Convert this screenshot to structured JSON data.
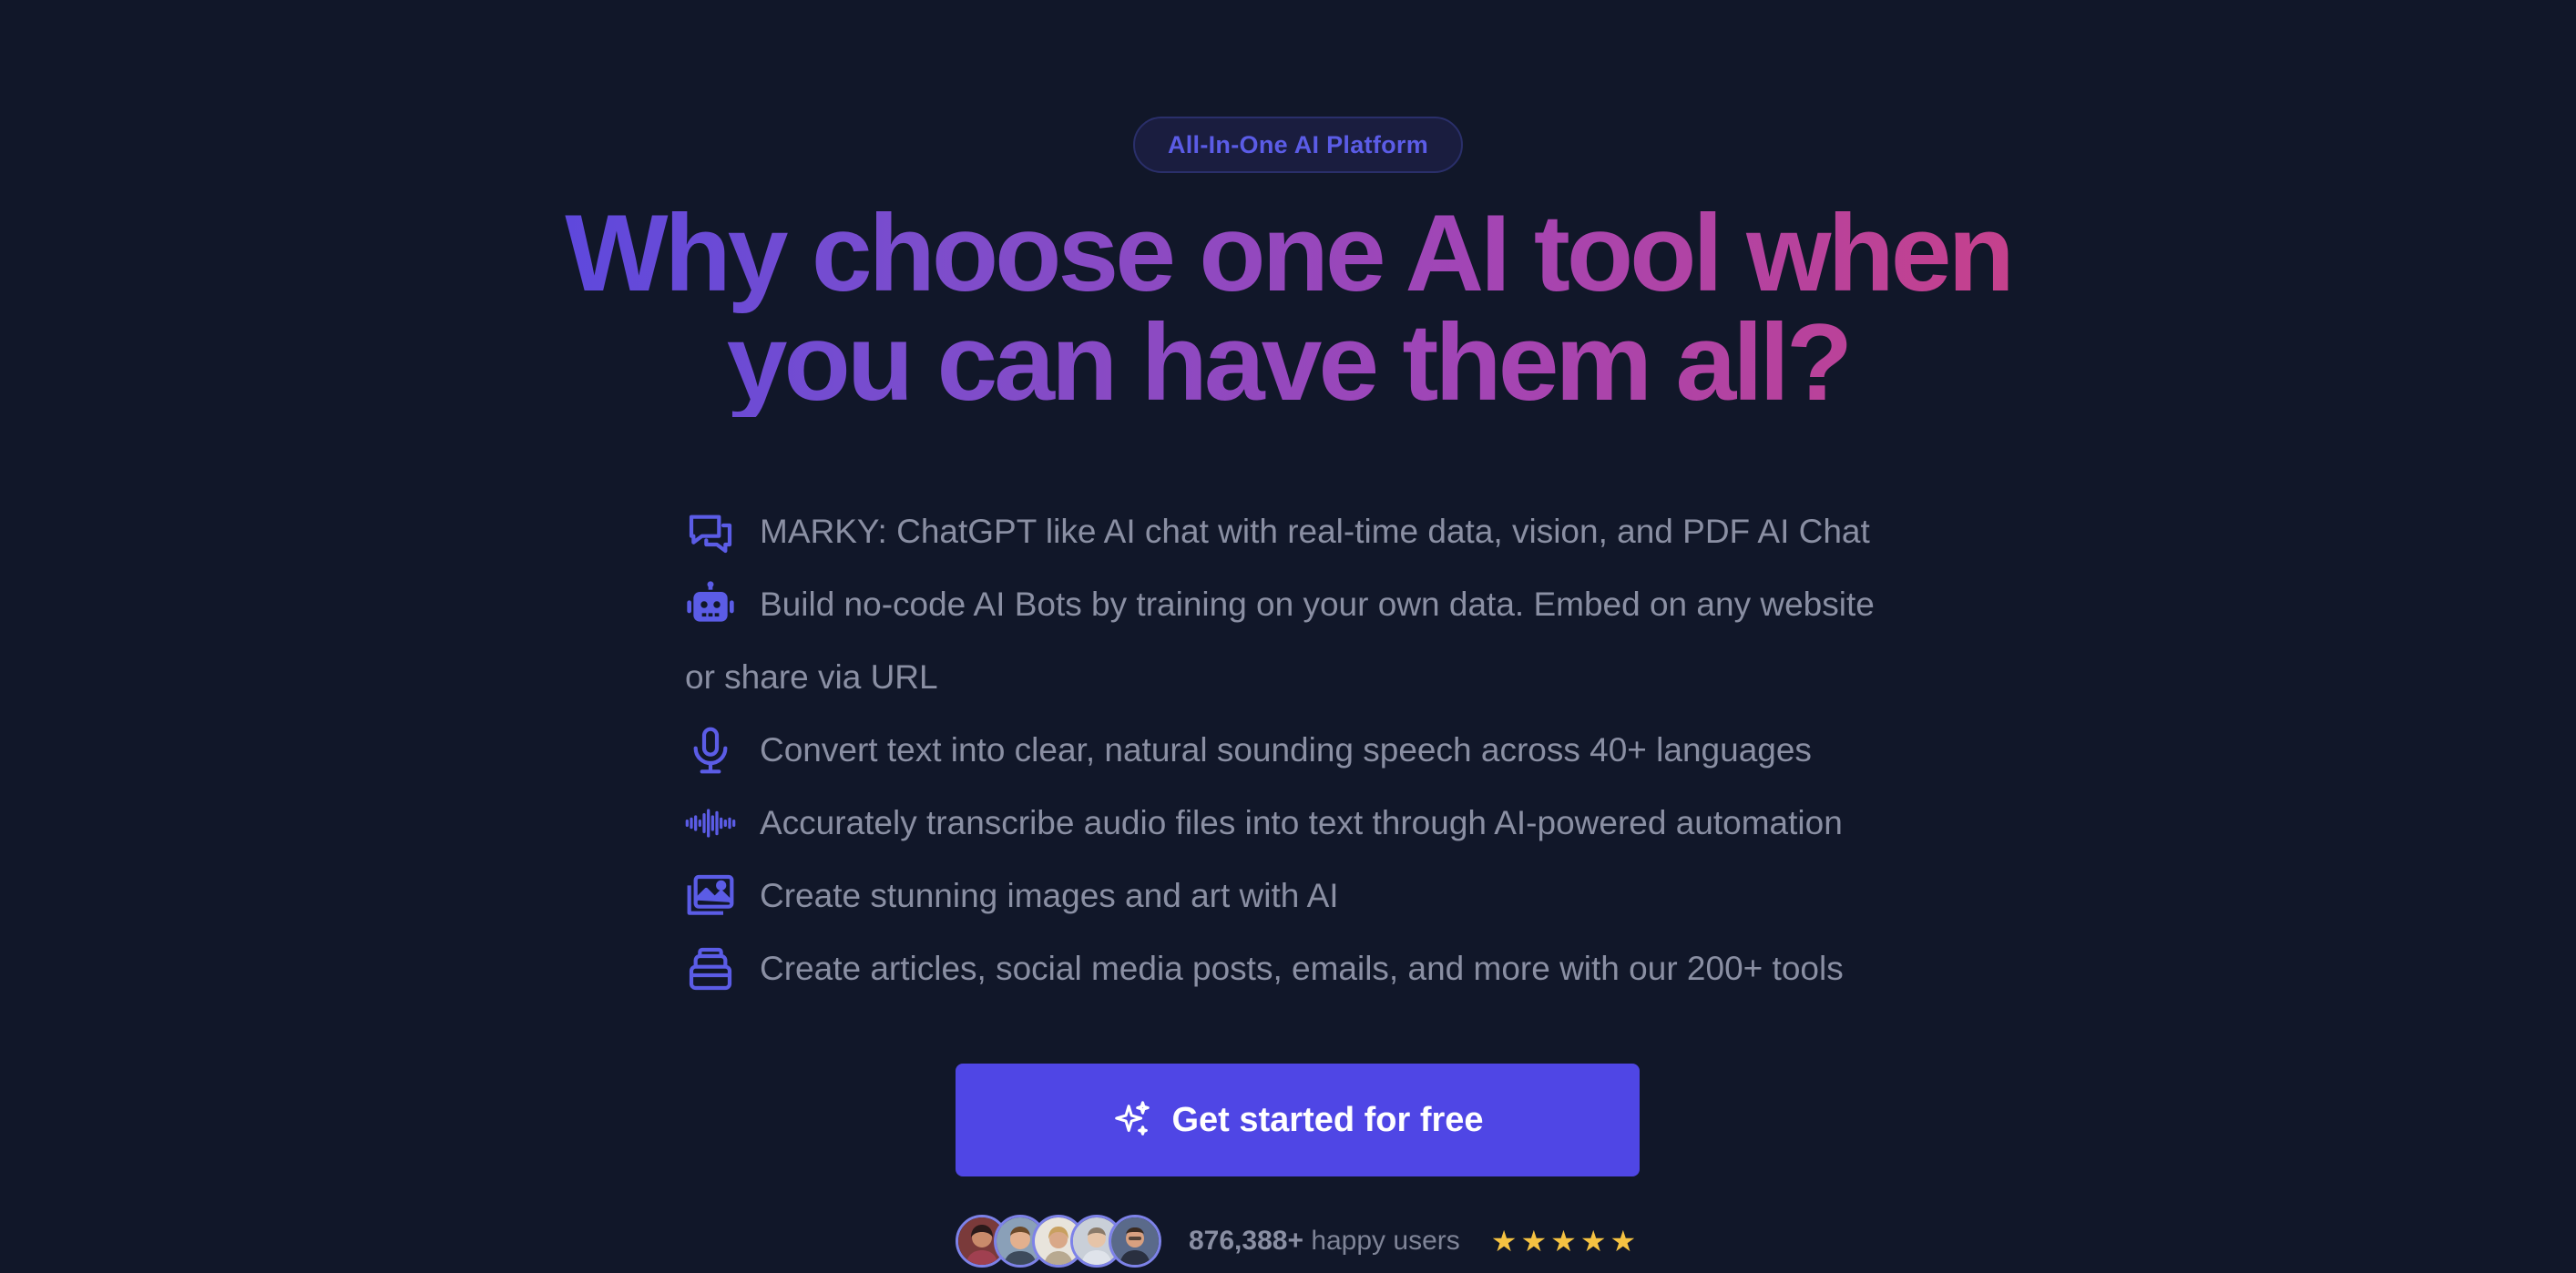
{
  "badge": {
    "label": "All-In-One AI Platform"
  },
  "headline": {
    "line1": "Why choose one AI tool when",
    "line2": "you can have them all?"
  },
  "features": [
    {
      "icon": "chat-bubbles-icon",
      "text": "MARKY: ChatGPT like AI chat with real-time data, vision, and PDF AI Chat"
    },
    {
      "icon": "robot-icon",
      "text": "Build no-code AI Bots by training on your own data. Embed on any website or share via URL"
    },
    {
      "icon": "microphone-icon",
      "text": "Convert text into clear, natural sounding speech across 40+ languages"
    },
    {
      "icon": "waveform-icon",
      "text": "Accurately transcribe audio files into text through AI-powered automation"
    },
    {
      "icon": "image-gallery-icon",
      "text": "Create stunning images and art with AI"
    },
    {
      "icon": "stack-icon",
      "text": "Create articles, social media posts, emails, and more with our 200+ tools"
    }
  ],
  "cta": {
    "label": "Get started for free",
    "icon": "sparkles-icon"
  },
  "social_proof": {
    "count": "876,388+",
    "label": "happy users",
    "stars": 5,
    "avatars": 5
  },
  "colors": {
    "background": "#111729",
    "accent": "#4f46e5",
    "star": "#f5c242"
  }
}
